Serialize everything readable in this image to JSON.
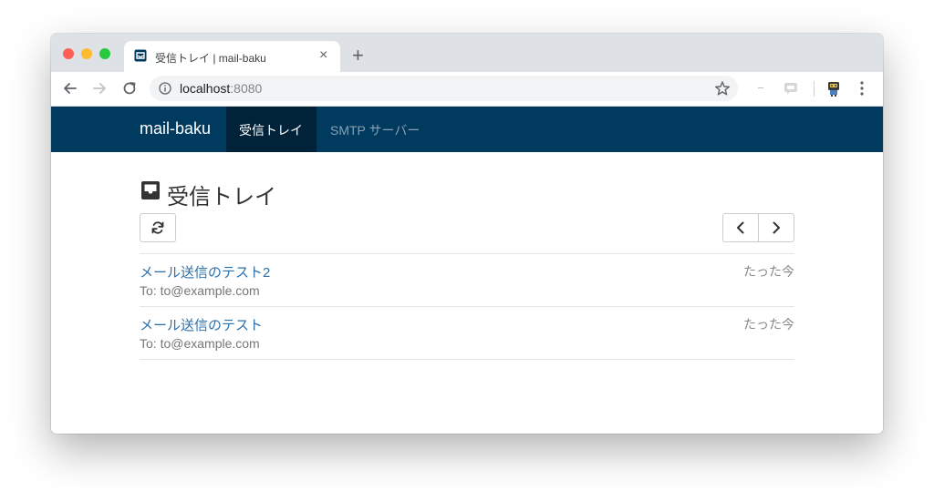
{
  "browser": {
    "tab_title": "受信トレイ | mail-baku",
    "tab_close": "×",
    "new_tab": "+",
    "url_host": "localhost",
    "url_port": ":8080"
  },
  "nav": {
    "brand": "mail-baku",
    "items": [
      {
        "label": "受信トレイ",
        "active": true
      },
      {
        "label": "SMTP サーバー",
        "active": false
      }
    ]
  },
  "page": {
    "title": "受信トレイ"
  },
  "messages": [
    {
      "subject": "メール送信のテスト2",
      "to": "To: to@example.com",
      "time": "たった今"
    },
    {
      "subject": "メール送信のテスト",
      "to": "To: to@example.com",
      "time": "たった今"
    }
  ],
  "colors": {
    "navbar": "#003a5e",
    "navbar_active": "#002339",
    "link": "#2a6fad"
  }
}
